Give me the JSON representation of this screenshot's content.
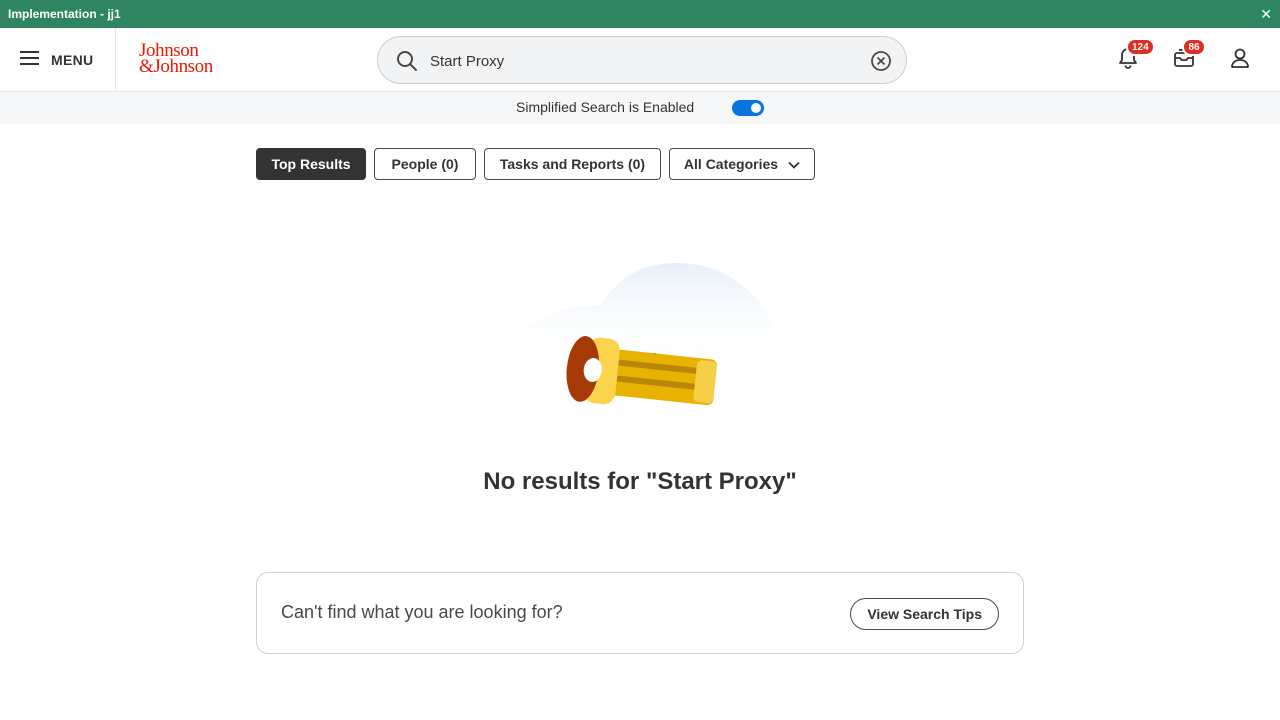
{
  "environment": {
    "title": "Implementation - jj1",
    "close_glyph": "✕"
  },
  "header": {
    "menu_label": "MENU",
    "logo_line1": "Johnson",
    "logo_line2": "&Johnson",
    "search": {
      "value": "Start Proxy",
      "placeholder": "Search"
    },
    "notifications": {
      "count": "124",
      "icon": "bell-icon"
    },
    "inbox": {
      "count": "86",
      "icon": "inbox-icon"
    },
    "profile": {
      "icon": "user-icon"
    }
  },
  "simplified_search": {
    "label": "Simplified Search is Enabled",
    "enabled": true
  },
  "tabs": [
    {
      "label": "Top Results",
      "active": true
    },
    {
      "label": "People (0)",
      "active": false
    },
    {
      "label": "Tasks and Reports (0)",
      "active": false
    },
    {
      "label": "All Categories",
      "active": false,
      "dropdown": true
    }
  ],
  "empty_state": {
    "icon": "flashlight-illustration",
    "message": "No results for \"Start Proxy\""
  },
  "tips_card": {
    "text": "Can't find what you are looking for?",
    "button_label": "View Search Tips"
  },
  "colors": {
    "env_bar": "#2e8560",
    "brand_red": "#eb1700",
    "badge_red": "#de2e21",
    "toggle_blue": "#0875e1"
  }
}
